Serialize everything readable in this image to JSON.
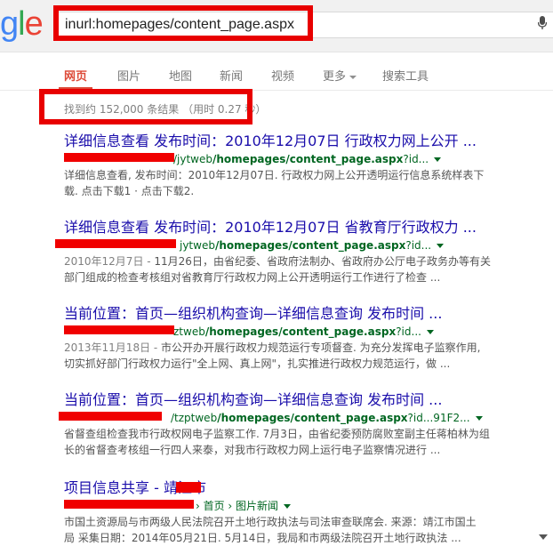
{
  "search": {
    "logo_text": "gle",
    "query": "inurl:homepages/content_page.aspx"
  },
  "tabs": [
    "网页",
    "图片",
    "地图",
    "新闻",
    "视频",
    "更多",
    "搜索工具"
  ],
  "stats": "找到约 152,000 条结果 （用时 0.27 秒）",
  "results": [
    {
      "title": "详细信息查看 发布时间：2010年12月07日 行政权力网上公开 ...",
      "url_prefix": "/jytweb",
      "url_bold": "/homepages/content_page.aspx",
      "url_suffix": "?id...",
      "snippet1": "详细信息查看, 发布时间：2010年12月07日. 行政权力网上公开透明运行信息系统样表下",
      "snippet2": "载. 点击下载1 · 点击下载2."
    },
    {
      "title": "详细信息查看 发布时间：2010年12月07日 省教育厅行政权力 ...",
      "url_prefix": "jytweb",
      "url_bold": "/homepages/content_page.aspx",
      "url_suffix": "?id...",
      "date": "2010年12月7日 - ",
      "snippet1": "11月26日，由省纪委、省政府法制办、省政府办公厅电子政务办等有关",
      "snippet2": "部门组成的检查考核组对省教育厅行政权力网上公开透明运行工作进行了检查 ..."
    },
    {
      "title": "当前位置：首页—组织机构查询—详细信息查询 发布时间 ...",
      "url_prefix": "ztweb",
      "url_bold": "/homepages/content_page.aspx",
      "url_suffix": "?id...",
      "date": "2013年11月18日 - ",
      "snippet1": "市公开办开展行政权力规范运行专项督查. 为充分发挥电子监察作用,",
      "snippet2": "切实抓好部门行政权力运行\"全上网、真上网\"，扎实推进行政权力规范运行，做 ..."
    },
    {
      "title": "当前位置：首页—组织机构查询—详细信息查询 发布时间 ...",
      "url_prefix": "/tzptweb",
      "url_bold": "/homepages/content_page.aspx",
      "url_suffix": "?id...91F2...",
      "snippet1": "省督查组检查我市行政权网电子监察工作. 7月3日，由省纪委预防腐败室副主任蒋柏林为组",
      "snippet2": "长的省督查考核组一行四人来泰，对我市行政权力网上运行电子监察情况进行 ..."
    },
    {
      "title": "项目信息共享 - 靖江市",
      "url_prefix": "",
      "url_bold": "",
      "url_suffix": "› 首页 › 图片新闻",
      "snippet1": "市国土资源局与市两级人民法院召开土地行政执法与司法审查联席会. 来源：靖江市国土",
      "snippet2": "局 采集日期：2014年05月21日. 5月14日，我局和市两级法院召开土地行政执法 ..."
    }
  ]
}
